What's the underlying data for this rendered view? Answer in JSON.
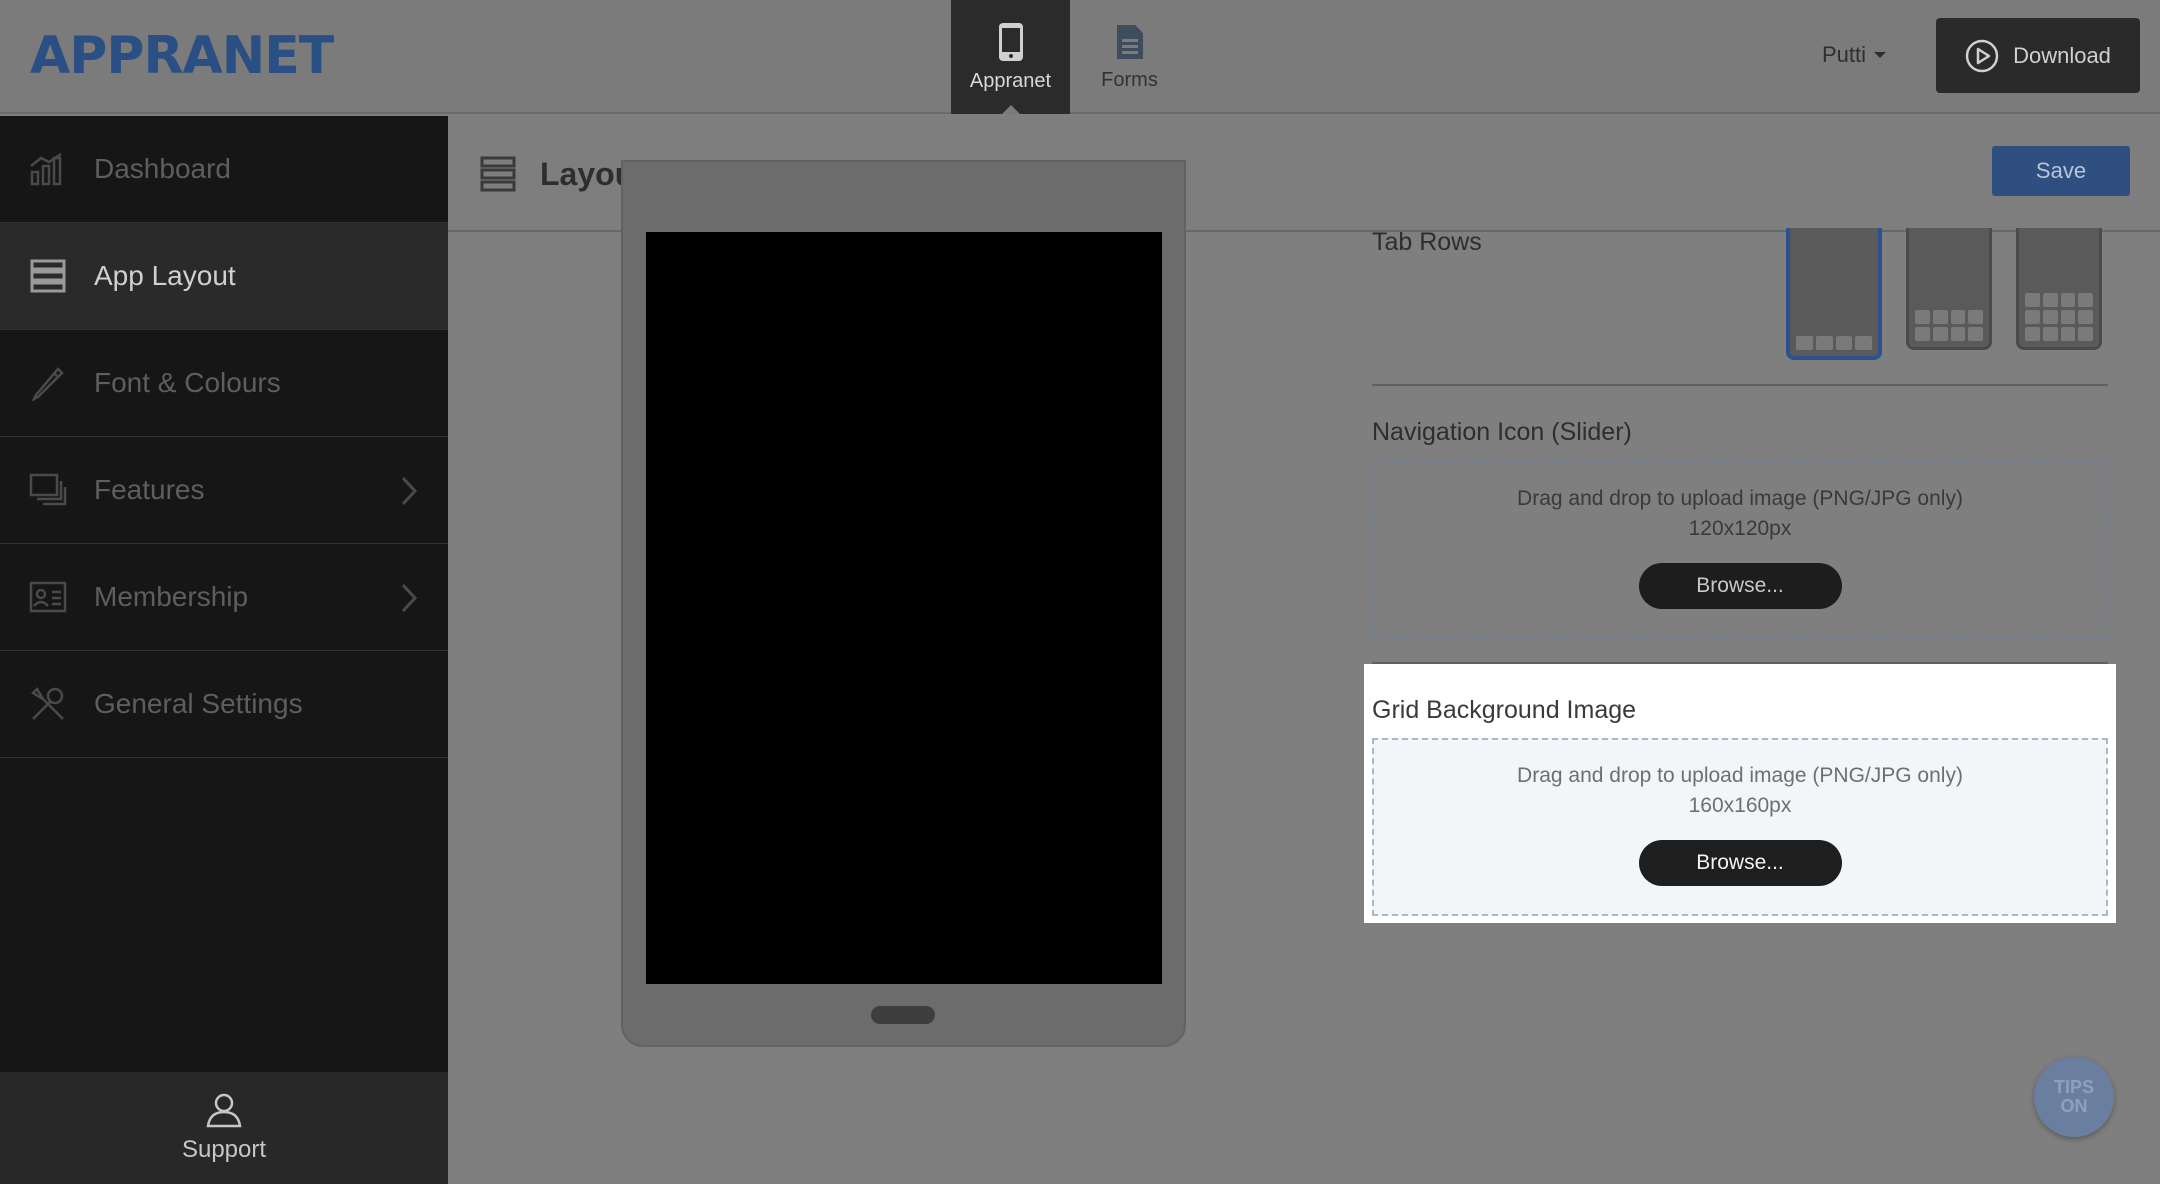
{
  "app": {
    "logo": "APPRANET"
  },
  "topnav": {
    "tabs": [
      {
        "label": "Appranet",
        "icon": "phone-icon",
        "active": true
      },
      {
        "label": "Forms",
        "icon": "document-icon",
        "active": false
      }
    ],
    "user": "Putti",
    "download_label": "Download"
  },
  "sidebar": {
    "items": [
      {
        "label": "Dashboard",
        "icon": "bar-chart-icon"
      },
      {
        "label": "App Layout",
        "icon": "layout-icon",
        "active": true
      },
      {
        "label": "Font & Colours",
        "icon": "pencil-icon"
      },
      {
        "label": "Features",
        "icon": "stack-icon",
        "has_submenu": true
      },
      {
        "label": "Membership",
        "icon": "id-card-icon",
        "has_submenu": true
      },
      {
        "label": "General Settings",
        "icon": "tools-icon"
      }
    ],
    "support_label": "Support"
  },
  "main": {
    "title": "Layout",
    "save_label": "Save"
  },
  "settings": {
    "tab_rows": {
      "label": "Tab Rows",
      "options": [
        {
          "rows": 1,
          "selected": true
        },
        {
          "rows": 2,
          "selected": false
        },
        {
          "rows": 3,
          "selected": false
        }
      ]
    },
    "nav_icon": {
      "label": "Navigation Icon (Slider)",
      "hint": "Drag and drop to upload image (PNG/JPG only)",
      "size": "120x120px",
      "browse_label": "Browse..."
    },
    "grid_bg": {
      "label": "Grid Background Image",
      "hint": "Drag and drop to upload image (PNG/JPG only)",
      "size": "160x160px",
      "browse_label": "Browse..."
    }
  },
  "tips": {
    "line1": "TIPS",
    "line2": "ON"
  }
}
